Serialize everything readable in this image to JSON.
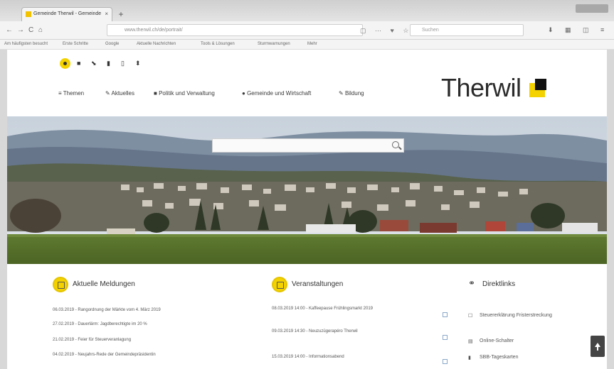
{
  "browser": {
    "tab_title": "Gemeinde Therwil - Gemeinde",
    "tab_close": "×",
    "new_tab": "+",
    "url": "www.therwil.ch/de/portrait/",
    "search_placeholder": "Suchen",
    "nav_back": "←",
    "nav_forward": "→",
    "reload": "C",
    "home": "⌂",
    "toolbar_icons": "▢ ⋯ ♥ ☆",
    "toolbar_right": "⬇ ▦ ◫ ≡",
    "bookmarks": [
      "Am häufigsten besucht",
      "Erste Schritte",
      "Google",
      "Aktuelle Nachrichten",
      "Tools & Lösungen",
      "Sturmwarnungen",
      "Mehr"
    ]
  },
  "site": {
    "quick_icons": [
      "●",
      "■",
      "⬊",
      "▮",
      "▯",
      "⬍"
    ],
    "nav": [
      {
        "icon": "≡",
        "label": "Themen"
      },
      {
        "icon": "✎",
        "label": "Aktuelles"
      },
      {
        "icon": "■",
        "label": "Politik und Verwaltung"
      },
      {
        "icon": "●",
        "label": "Gemeinde und Wirtschaft"
      },
      {
        "icon": "✎",
        "label": "Bildung"
      }
    ],
    "logo": "Therwil",
    "logo_colors": {
      "yellow": "#f3d200",
      "black": "#111111"
    },
    "search_placeholder": ""
  },
  "news": {
    "title": "Aktuelle Meldungen",
    "items": [
      "06.03.2019 - Rangordnung der Märkte vom 4. März 2019",
      "27.02.2019 - Dauerlärm: Jagdberechtigte im 20 %",
      "21.02.2019 - Feier für Steuerveranlagung",
      "04.02.2019 - Neujahrs-Rede der Gemeindepräsidentin"
    ]
  },
  "events": {
    "title": "Veranstaltungen",
    "items": [
      "08.03.2019 14:00 - Kaffeepause Frühlingsmarkt 2019",
      "09.03.2019 14:30 - Neuzuzügerapéro Therwil",
      "15.03.2019 14:00 - Informationsabend"
    ]
  },
  "links": {
    "title": "Direktlinks",
    "items": [
      {
        "icon": "☐",
        "label": "Steuererklärung Fristerstreckung"
      },
      {
        "icon": "▤",
        "label": "Online-Schalter"
      },
      {
        "icon": "▮",
        "label": "SBB-Tageskarten"
      }
    ]
  }
}
